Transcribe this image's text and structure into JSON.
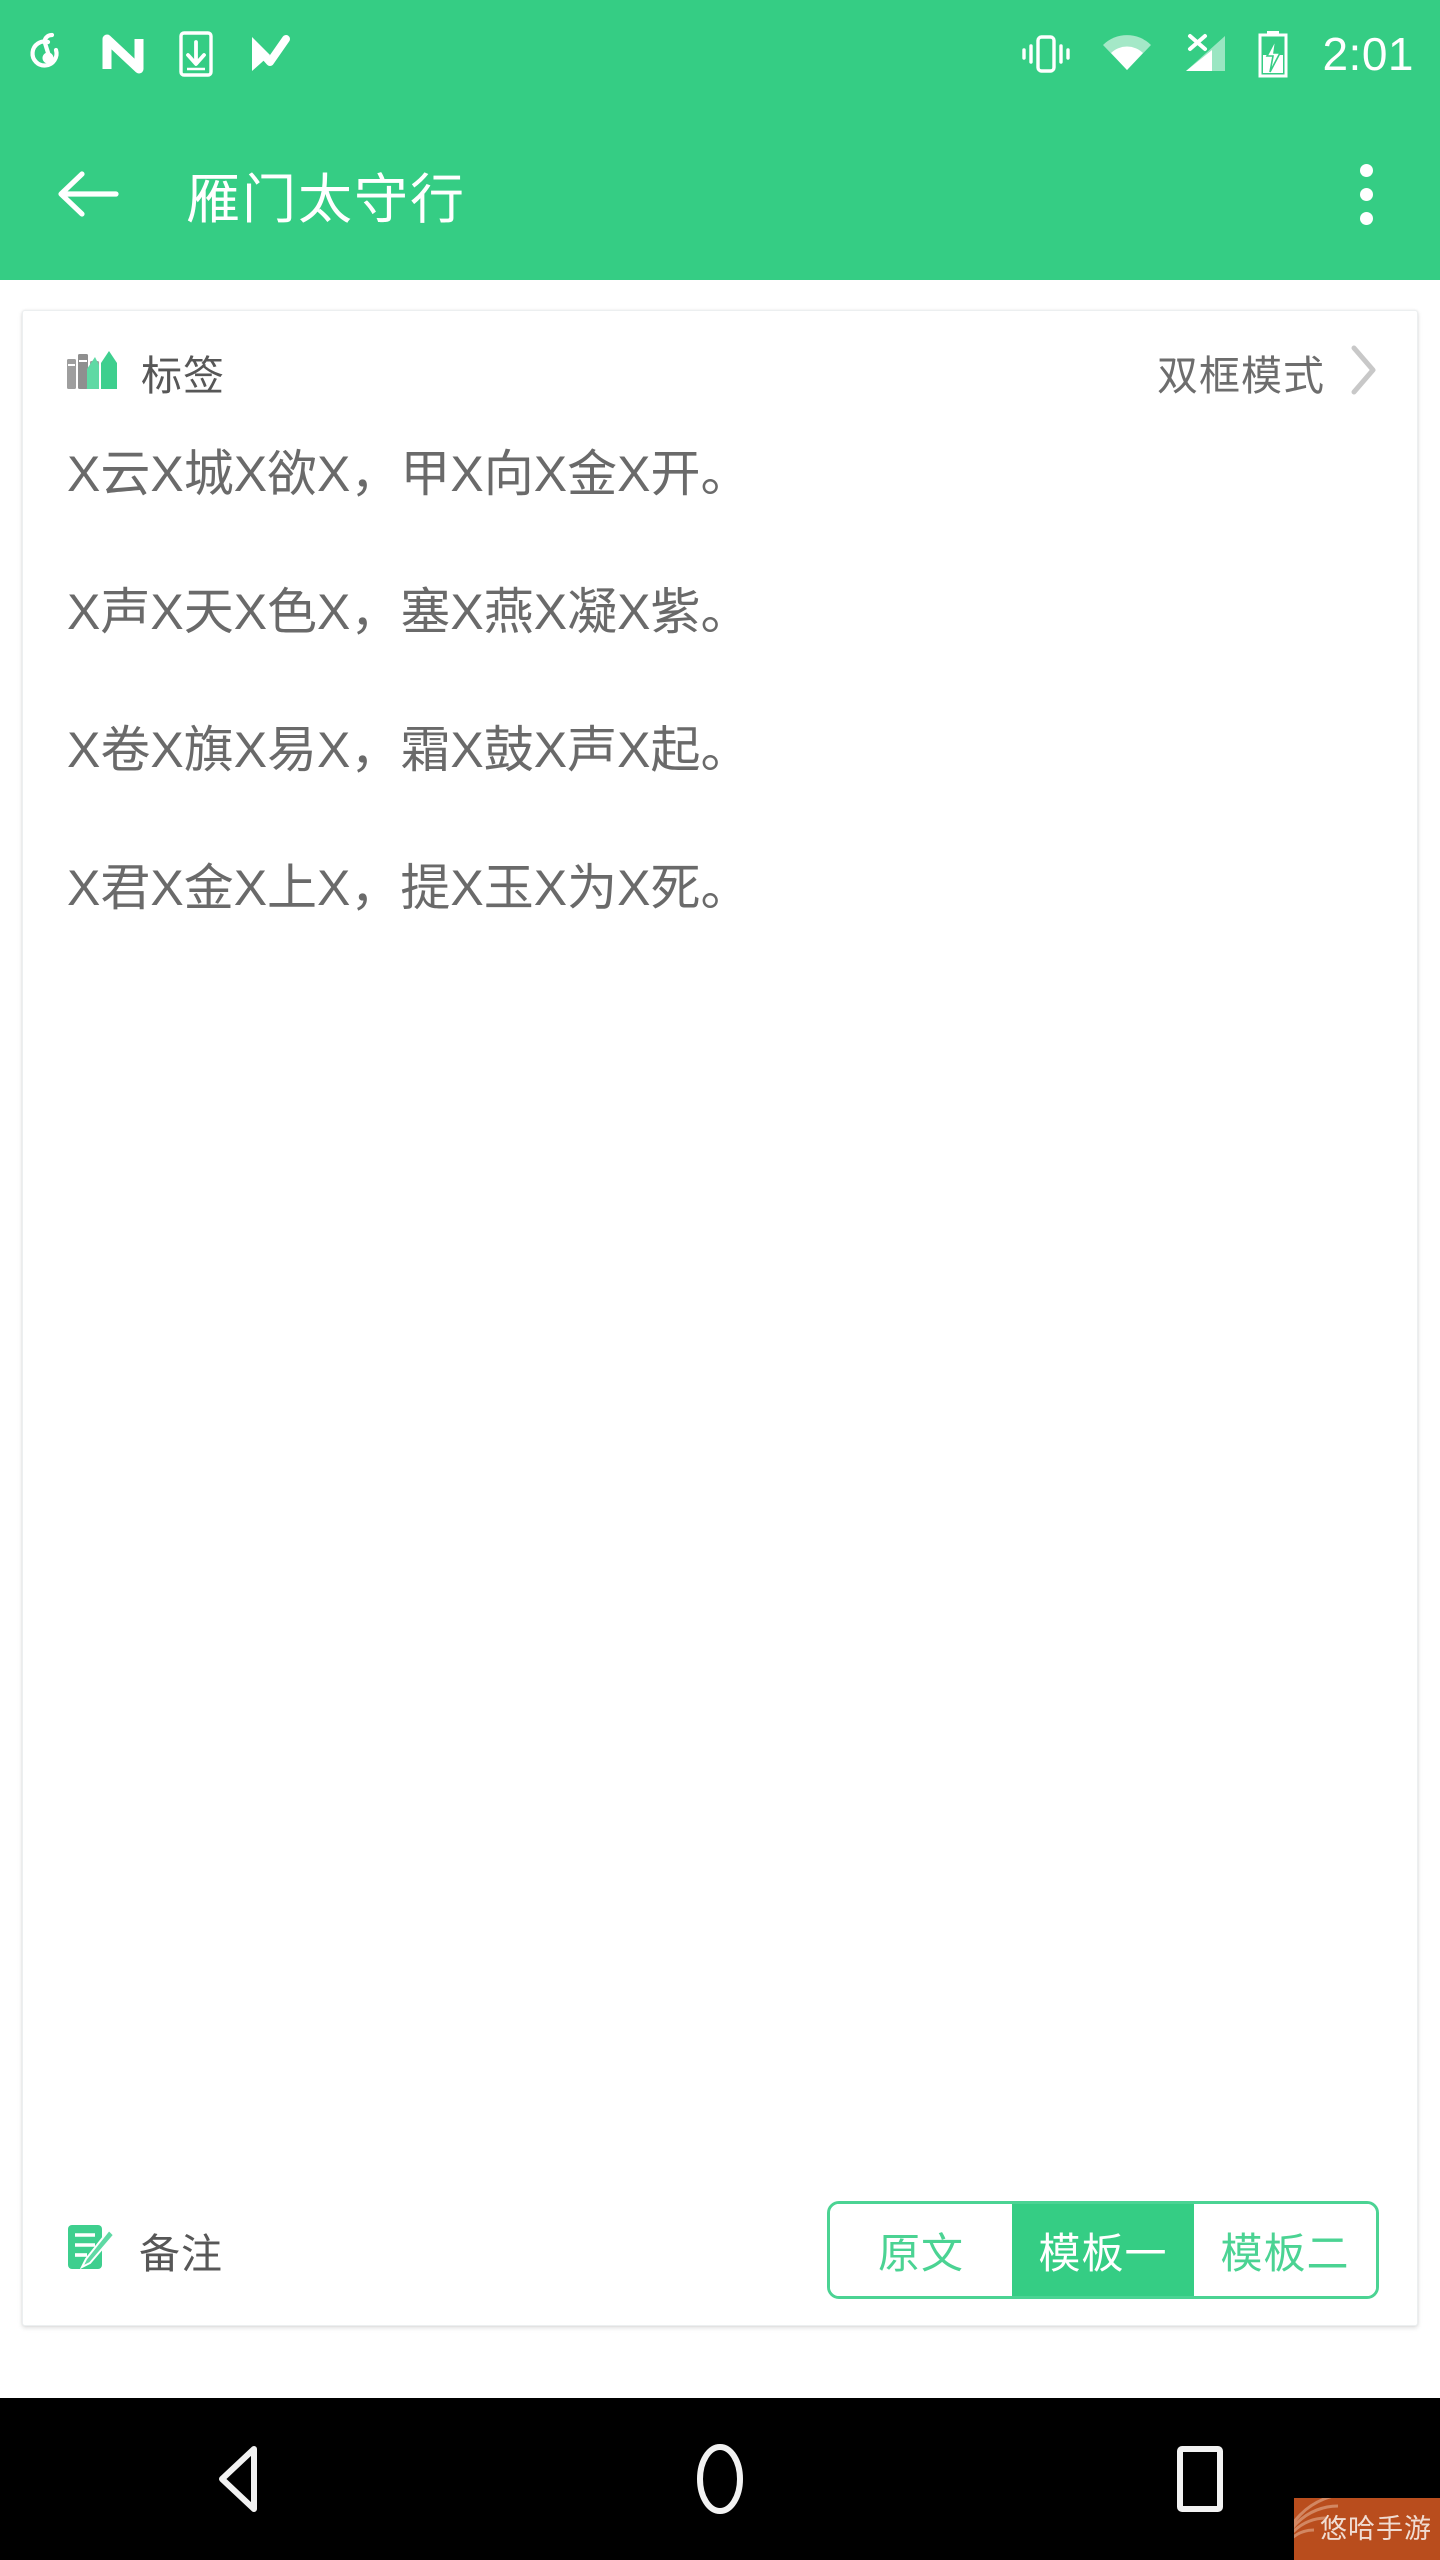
{
  "statusbar": {
    "left_icons": [
      "netease-music-icon",
      "nfc-icon",
      "download-to-phone-icon",
      "checkmark-flag-icon"
    ],
    "right_icons": [
      "vibrate-icon",
      "wifi-icon",
      "signal-off-icon",
      "battery-charging-icon"
    ],
    "time": "2:01"
  },
  "appbar": {
    "back_icon": "arrow-left-icon",
    "title": "雁门太守行",
    "overflow_icon": "more-vertical-icon"
  },
  "card": {
    "header": {
      "tag_icon": "books-icon",
      "tag_label": "标签",
      "mode_label": "双框模式",
      "mode_chevron_icon": "chevron-right-icon"
    },
    "poem_lines": [
      "X云X城X欲X，甲X向X金X开。",
      "X声X天X色X，塞X燕X凝X紫。",
      "X卷X旗X易X，霜X鼓X声X起。",
      "X君X金X上X，提X玉X为X死。"
    ],
    "footer": {
      "note_icon": "note-edit-icon",
      "note_label": "备注",
      "segments": [
        {
          "label": "原文",
          "active": false
        },
        {
          "label": "模板一",
          "active": true
        },
        {
          "label": "模板二",
          "active": false
        }
      ]
    }
  },
  "navbar": {
    "back_icon": "nav-back-triangle-icon",
    "home_icon": "nav-home-circle-icon",
    "recents_icon": "nav-recents-square-icon"
  },
  "watermark": {
    "text": "悠哈手游"
  },
  "colors": {
    "accent_green": "#35cd84",
    "segment_border_green": "#4bd393",
    "text_gray": "#6a6a6a",
    "label_gray": "#575757",
    "card_bg": "#ffffff",
    "nav_bg": "#000000",
    "watermark_bg": "#b94d1d"
  }
}
